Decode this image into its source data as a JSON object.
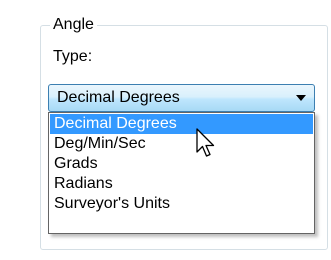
{
  "angle_group": {
    "title": "Angle",
    "type_label": "Type:"
  },
  "combo": {
    "selected_value": "Decimal Degrees",
    "options": [
      "Decimal Degrees",
      "Deg/Min/Sec",
      "Grads",
      "Radians",
      "Surveyor's Units"
    ],
    "highlighted_index": 0
  },
  "colors": {
    "selection_bg": "#3399ff",
    "combo_border": "#3c7fb1",
    "group_border": "#d5dfe5"
  },
  "icons": {
    "dropdown_arrow": "chevron-down-icon",
    "cursor": "mouse-pointer-icon"
  }
}
